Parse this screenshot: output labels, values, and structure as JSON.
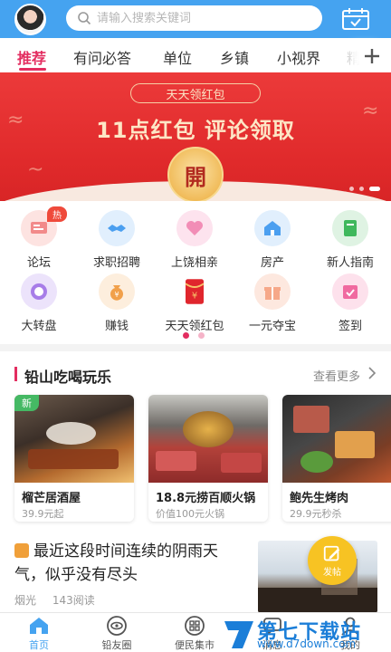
{
  "header": {
    "search_placeholder": "请输入搜索关键词",
    "accent": "#45a3f0"
  },
  "tabs": [
    {
      "label": "推荐",
      "active": true
    },
    {
      "label": "有问必答"
    },
    {
      "label": "单位"
    },
    {
      "label": "乡镇"
    },
    {
      "label": "小视界"
    },
    {
      "label": "精"
    }
  ],
  "banner": {
    "pill": "天天领红包",
    "title": "11点红包 评论领取",
    "button": "開"
  },
  "grid": {
    "hot_badge": "热",
    "items": [
      {
        "label": "论坛",
        "icon": "forum-icon",
        "color": "#f28a8a"
      },
      {
        "label": "求职招聘",
        "icon": "handshake-icon",
        "color": "#4b9ff0"
      },
      {
        "label": "上饶相亲",
        "icon": "heart-icon",
        "color": "#f28db6"
      },
      {
        "label": "房产",
        "icon": "house-icon",
        "color": "#4b9ff0"
      },
      {
        "label": "新人指南",
        "icon": "book-icon",
        "color": "#3fb85c"
      },
      {
        "label": "大转盘",
        "icon": "wheel-icon",
        "color": "#a77de8"
      },
      {
        "label": "赚钱",
        "icon": "money-bag-icon",
        "color": "#f1a04a"
      },
      {
        "label": "天天领红包",
        "icon": "red-envelope-icon",
        "color": "#e0262d"
      },
      {
        "label": "一元夺宝",
        "icon": "gift-icon",
        "color": "#f6a889"
      },
      {
        "label": "签到",
        "icon": "calendar-check-icon",
        "color": "#f06aa0"
      }
    ]
  },
  "section": {
    "title": "铅山吃喝玩乐",
    "more": "查看更多"
  },
  "cards": [
    {
      "badge": "新",
      "title": "榴芒居酒屋",
      "sub": "39.9元起"
    },
    {
      "title": "18.8元捞百顺火锅",
      "sub": "价值100元火锅"
    },
    {
      "title": "鲍先生烤肉",
      "sub": "29.9元秒杀"
    }
  ],
  "news": {
    "title": "最近这段时间连续的阴雨天气，似乎没有尽头",
    "author": "烟光",
    "reads": "143阅读"
  },
  "post_button": "发帖",
  "bottom_nav": [
    {
      "label": "首页",
      "icon": "home-icon",
      "active": true
    },
    {
      "label": "铅友圈",
      "icon": "eye-circle-icon"
    },
    {
      "label": "便民集市",
      "icon": "grid-icon"
    },
    {
      "label": "消息",
      "icon": "message-icon"
    },
    {
      "label": "我的",
      "icon": "user-icon"
    }
  ],
  "watermark": {
    "text": "第七下载站",
    "url": "www.d7down.com"
  }
}
